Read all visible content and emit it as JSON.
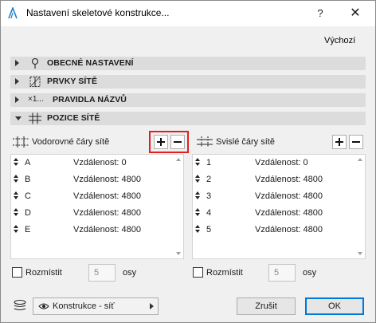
{
  "window": {
    "title": "Nastavení skeletové konstrukce...",
    "help": "?",
    "close": "✕"
  },
  "toolbar": {
    "default_label": "Výchozí"
  },
  "sections": [
    {
      "label": "OBECNÉ NASTAVENÍ",
      "expanded": false,
      "icon": "pin-icon"
    },
    {
      "label": "PRVKY SÍTĚ",
      "expanded": false,
      "icon": "grid-element-icon"
    },
    {
      "label": "PRAVIDLA NÁZVŮ",
      "expanded": false,
      "icon": "naming-icon",
      "icon_text": "×1..."
    },
    {
      "label": "POZICE SÍTĚ",
      "expanded": true,
      "icon": "grid-position-icon"
    }
  ],
  "horizontal": {
    "label": "Vodorovné čáry sítě",
    "rows": [
      {
        "name": "A",
        "distance": "Vzdálenost: 0"
      },
      {
        "name": "B",
        "distance": "Vzdálenost: 4800"
      },
      {
        "name": "C",
        "distance": "Vzdálenost: 4800"
      },
      {
        "name": "D",
        "distance": "Vzdálenost: 4800"
      },
      {
        "name": "E",
        "distance": "Vzdálenost: 4800"
      }
    ],
    "distribute_label": "Rozmístit",
    "distribute_checked": false,
    "count_value": "5",
    "count_unit": "osy"
  },
  "vertical": {
    "label": "Svislé čáry sítě",
    "rows": [
      {
        "name": "1",
        "distance": "Vzdálenost: 0"
      },
      {
        "name": "2",
        "distance": "Vzdálenost: 4800"
      },
      {
        "name": "3",
        "distance": "Vzdálenost: 4800"
      },
      {
        "name": "4",
        "distance": "Vzdálenost: 4800"
      },
      {
        "name": "5",
        "distance": "Vzdálenost: 4800"
      }
    ],
    "distribute_label": "Rozmístit",
    "distribute_checked": false,
    "count_value": "5",
    "count_unit": "osy"
  },
  "footer": {
    "layer_value": "Konstrukce - síť",
    "cancel_label": "Zrušit",
    "ok_label": "OK"
  },
  "colors": {
    "highlight": "#e02020",
    "primary_border": "#0078d7",
    "section_bg": "#dcdcdc"
  }
}
